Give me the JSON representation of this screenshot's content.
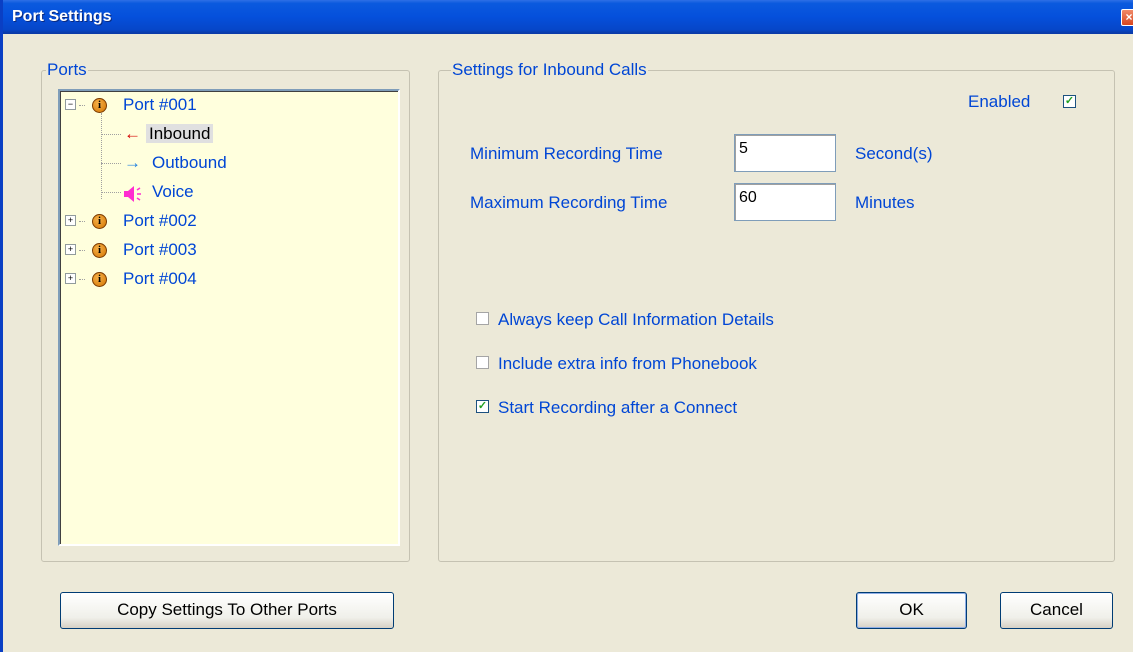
{
  "window": {
    "title": "Port Settings",
    "close_glyph": "×"
  },
  "ports_group": {
    "caption": "Ports"
  },
  "tree": {
    "ports": [
      {
        "label": "Port #001",
        "expanded": true,
        "expander": "−",
        "info_glyph": "i"
      },
      {
        "label": "Port #002",
        "expanded": false,
        "expander": "+",
        "info_glyph": "i"
      },
      {
        "label": "Port #003",
        "expanded": false,
        "expander": "+",
        "info_glyph": "i"
      },
      {
        "label": "Port #004",
        "expanded": false,
        "expander": "+",
        "info_glyph": "i"
      }
    ],
    "children": [
      {
        "label": "Inbound",
        "icon": "left-arrow-icon",
        "glyph": "←",
        "color": "#d40000",
        "selected": true
      },
      {
        "label": "Outbound",
        "icon": "right-arrow-icon",
        "glyph": "→",
        "color": "#1e7fe0",
        "selected": false
      },
      {
        "label": "Voice",
        "icon": "speaker-icon",
        "glyph": "◀",
        "color": "#ff2cd0",
        "selected": false
      }
    ]
  },
  "settings_group": {
    "caption": "Settings for Inbound Calls",
    "enabled": {
      "label": "Enabled",
      "checked": true
    },
    "min_recording": {
      "label": "Minimum Recording Time",
      "value": "5",
      "unit": "Second(s)"
    },
    "max_recording": {
      "label": "Maximum Recording Time",
      "value": "60",
      "unit": "Minutes"
    },
    "options": [
      {
        "label": "Always keep Call Information Details",
        "checked": false
      },
      {
        "label": "Include extra info from Phonebook",
        "checked": false
      },
      {
        "label": "Start Recording after a Connect",
        "checked": true
      }
    ]
  },
  "buttons": {
    "copy": "Copy Settings To Other Ports",
    "ok": "OK",
    "cancel": "Cancel"
  },
  "colors": {
    "accent": "#0046d5",
    "tree_background": "#ffffdd",
    "titlebar": "#0550dc"
  }
}
